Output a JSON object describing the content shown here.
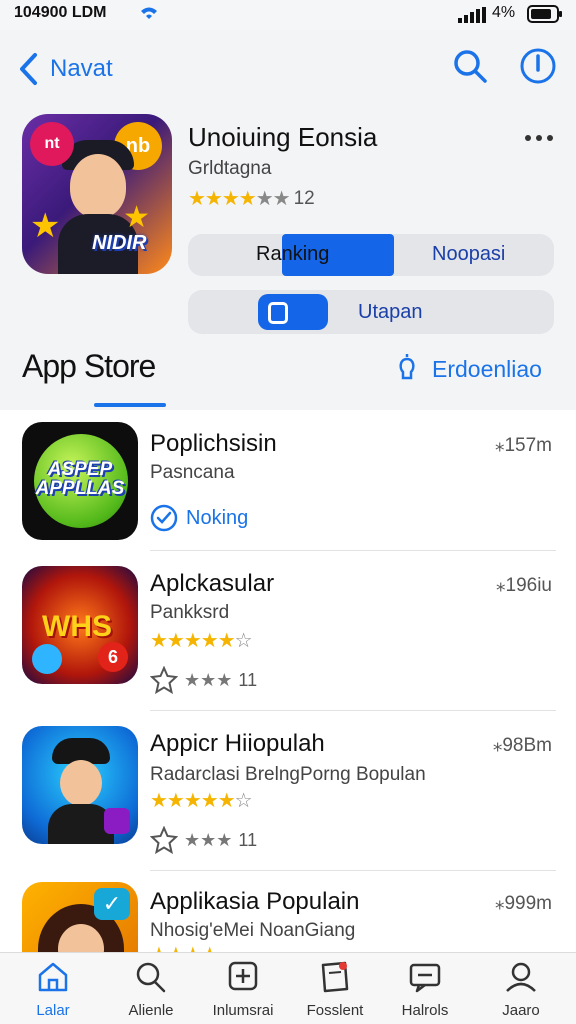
{
  "status_bar": {
    "time": "104900 LDM",
    "battery": "4%"
  },
  "nav": {
    "back_label": "Navat"
  },
  "featured_app": {
    "title": "Unoiuing Eonsia",
    "subtitle": "Grldtagna",
    "rating_count": "12",
    "icon_badge_left": "nt",
    "icon_badge_right": "nb",
    "icon_logo_text": "NIDIR"
  },
  "segment": {
    "left_label": "Ranking",
    "right_label": "Noopasi"
  },
  "toggle": {
    "label": "Utapan"
  },
  "section": {
    "title": "App Store",
    "link_label": "Erdoenliao"
  },
  "apps": [
    {
      "name": "Poplichsisin",
      "size": "⁎157m",
      "subtitle": "Pasncana",
      "action_label": "Noking",
      "icon_text": "ASPEP APPLLAS"
    },
    {
      "name": "Aplckasular",
      "size": "⁎196iu",
      "subtitle": "Pankksrd",
      "secondary_rating": "11",
      "icon_text": "WHS",
      "icon_badge": "6"
    },
    {
      "name": "Appicr Hiiopulah",
      "size": "⁎98Bm",
      "subtitle": "Radarclasi BrelngPorng Bopulan",
      "secondary_rating": "11"
    },
    {
      "name": "Applikasia Populain",
      "size": "⁎999m",
      "subtitle": "Nhosig'eMei NoanGiang"
    }
  ],
  "tabs": [
    {
      "label": "Lalar",
      "icon": "home-icon"
    },
    {
      "label": "Alienle",
      "icon": "search-icon"
    },
    {
      "label": "Inlumsrai",
      "icon": "add-box-icon"
    },
    {
      "label": "Fosslent",
      "icon": "bookmark-icon"
    },
    {
      "label": "Halrols",
      "icon": "message-icon"
    },
    {
      "label": "Jaaro",
      "icon": "profile-icon"
    }
  ],
  "colors": {
    "accent": "#1a73e8",
    "star": "#f5b400",
    "segment_active": "#1565e8"
  }
}
